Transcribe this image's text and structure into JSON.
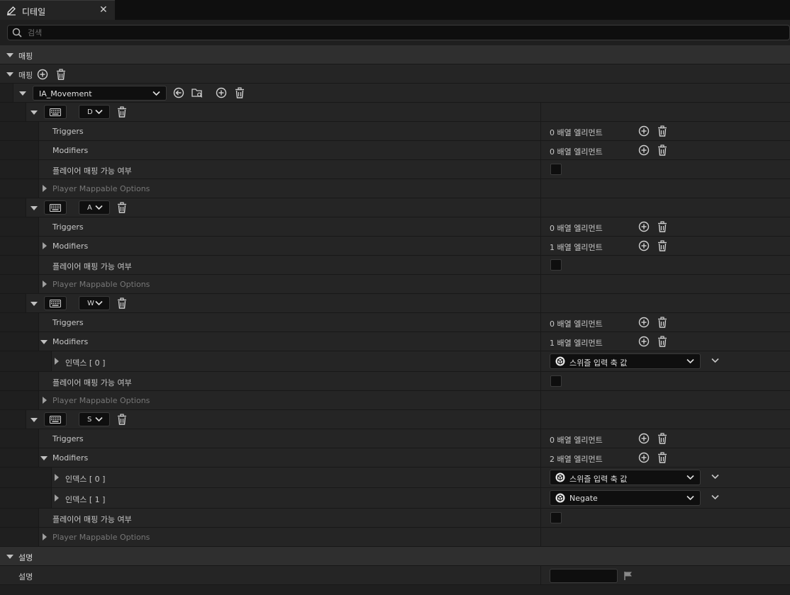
{
  "tab": {
    "title": "디테일",
    "close": "✕"
  },
  "search": {
    "placeholder": "검색"
  },
  "category_mapping": "매핑",
  "mappings_label": "매핑",
  "action": "IA_Movement",
  "groups": [
    {
      "key": "D",
      "triggers": {
        "label": "Triggers",
        "value": "0 배열 엘리먼트"
      },
      "modifiers": {
        "label": "Modifiers",
        "value": "0 배열 엘리먼트"
      },
      "mappable_label": "플레이어 매핑 가능 여부",
      "options_label": "Player Mappable Options"
    },
    {
      "key": "A",
      "triggers": {
        "label": "Triggers",
        "value": "0 배열 엘리먼트"
      },
      "modifiers": {
        "label": "Modifiers",
        "value": "1 배열 엘리먼트"
      },
      "mappable_label": "플레이어 매핑 가능 여부",
      "options_label": "Player Mappable Options"
    },
    {
      "key": "W",
      "triggers": {
        "label": "Triggers",
        "value": "0 배열 엘리먼트"
      },
      "modifiers": {
        "label": "Modifiers",
        "value": "1 배열 엘리먼트"
      },
      "indices": [
        {
          "label": "인덱스 [ 0 ]",
          "value": "스위즐 입력 축 값"
        }
      ],
      "mappable_label": "플레이어 매핑 가능 여부",
      "options_label": "Player Mappable Options"
    },
    {
      "key": "S",
      "triggers": {
        "label": "Triggers",
        "value": "0 배열 엘리먼트"
      },
      "modifiers": {
        "label": "Modifiers",
        "value": "2 배열 엘리먼트"
      },
      "indices": [
        {
          "label": "인덱스 [ 0 ]",
          "value": "스위즐 입력 축 값"
        },
        {
          "label": "인덱스 [ 1 ]",
          "value": "Negate"
        }
      ],
      "mappable_label": "플레이어 매핑 가능 여부",
      "options_label": "Player Mappable Options"
    }
  ],
  "category_description": "설명",
  "description_label": "설명",
  "description_value": ""
}
